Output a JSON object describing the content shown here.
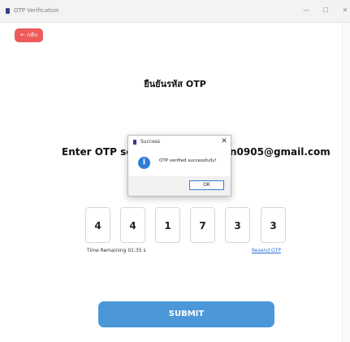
{
  "window": {
    "title": "OTP Verification",
    "minimize_glyph": "—",
    "maximize_glyph": "☐",
    "close_glyph": "✕"
  },
  "back_button": {
    "label": "← กลับ"
  },
  "heading": "ยืนยันรหัส OTP",
  "otp_message": {
    "visible_left": "Enter OTP sent t",
    "visible_right": "n0905@gmail.com"
  },
  "otp_digits": [
    "4",
    "4",
    "1",
    "7",
    "3",
    "3"
  ],
  "timer": {
    "label": "Time Remaining 01:35 s"
  },
  "resend_label": "Resend OTP",
  "submit_label": "SUBMIT",
  "dialog": {
    "title": "Success",
    "close_glyph": "✕",
    "icon_glyph": "i",
    "message": "OTP verified successfully!",
    "ok_label": "OK"
  },
  "colors": {
    "back_button": "#ef5a5a",
    "submit_button": "#4b97d8",
    "link": "#2f6fd6",
    "info_icon": "#2f7fd8"
  }
}
